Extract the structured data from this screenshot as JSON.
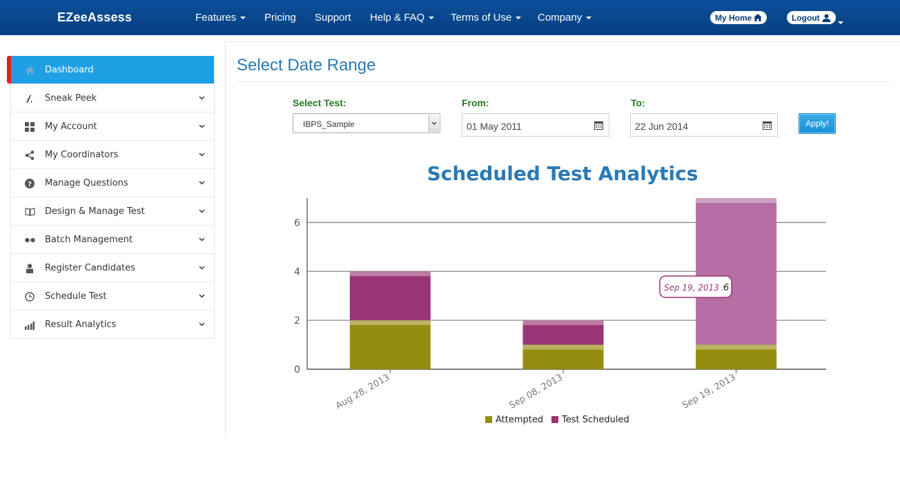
{
  "navbar": {
    "brand": "EZeeAssess",
    "items": [
      {
        "label": "Features",
        "dropdown": true
      },
      {
        "label": "Pricing",
        "dropdown": false
      },
      {
        "label": "Support",
        "dropdown": false
      },
      {
        "label": "Help & FAQ",
        "dropdown": true
      },
      {
        "label": "Terms of Use",
        "dropdown": true
      },
      {
        "label": "Company",
        "dropdown": true
      }
    ],
    "my_home": "My Home",
    "logout": "Logout"
  },
  "sidebar": {
    "items": [
      {
        "label": "Dashboard",
        "icon": "home-icon",
        "active": true
      },
      {
        "label": "Sneak Peek",
        "icon": "pen-icon"
      },
      {
        "label": "My Account",
        "icon": "grid-icon"
      },
      {
        "label": "My Coordinators",
        "icon": "share-icon"
      },
      {
        "label": "Manage Questions",
        "icon": "question-icon"
      },
      {
        "label": "Design & Manage Test",
        "icon": "book-icon"
      },
      {
        "label": "Batch Management",
        "icon": "dots-icon"
      },
      {
        "label": "Register Candidates",
        "icon": "user-icon"
      },
      {
        "label": "Schedule Test",
        "icon": "clock-icon"
      },
      {
        "label": "Result Analytics",
        "icon": "bar-chart-icon"
      }
    ]
  },
  "main": {
    "title": "Select Date Range",
    "select_test_label": "Select Test:",
    "select_test_value": "IBPS_Sample",
    "from_label": "From:",
    "from_value": "01 May 2011",
    "to_label": "To:",
    "to_value": "22 Jun 2014",
    "apply_label": "Apply!"
  },
  "colors": {
    "attempted": "#958d0f",
    "scheduled": "#993574",
    "scheduled_highlight": "#b56fa4",
    "accent": "#1fa0e4",
    "title": "#2a7ab5"
  },
  "tooltip": {
    "label": "Sep 19, 2013 :",
    "value": "6"
  },
  "chart_data": {
    "type": "bar",
    "stacked": true,
    "title": "Scheduled Test Analytics",
    "categories": [
      "Aug 28, 2013",
      "Sep 08, 2013",
      "Sep 19, 2013"
    ],
    "series": [
      {
        "name": "Attempted",
        "values": [
          2,
          1,
          1
        ]
      },
      {
        "name": "Test Scheduled",
        "values": [
          2,
          1,
          6
        ]
      }
    ],
    "ylim": [
      0,
      7
    ],
    "yticks": [
      0,
      2,
      4,
      6
    ],
    "grid": true,
    "legend": "bottom"
  }
}
